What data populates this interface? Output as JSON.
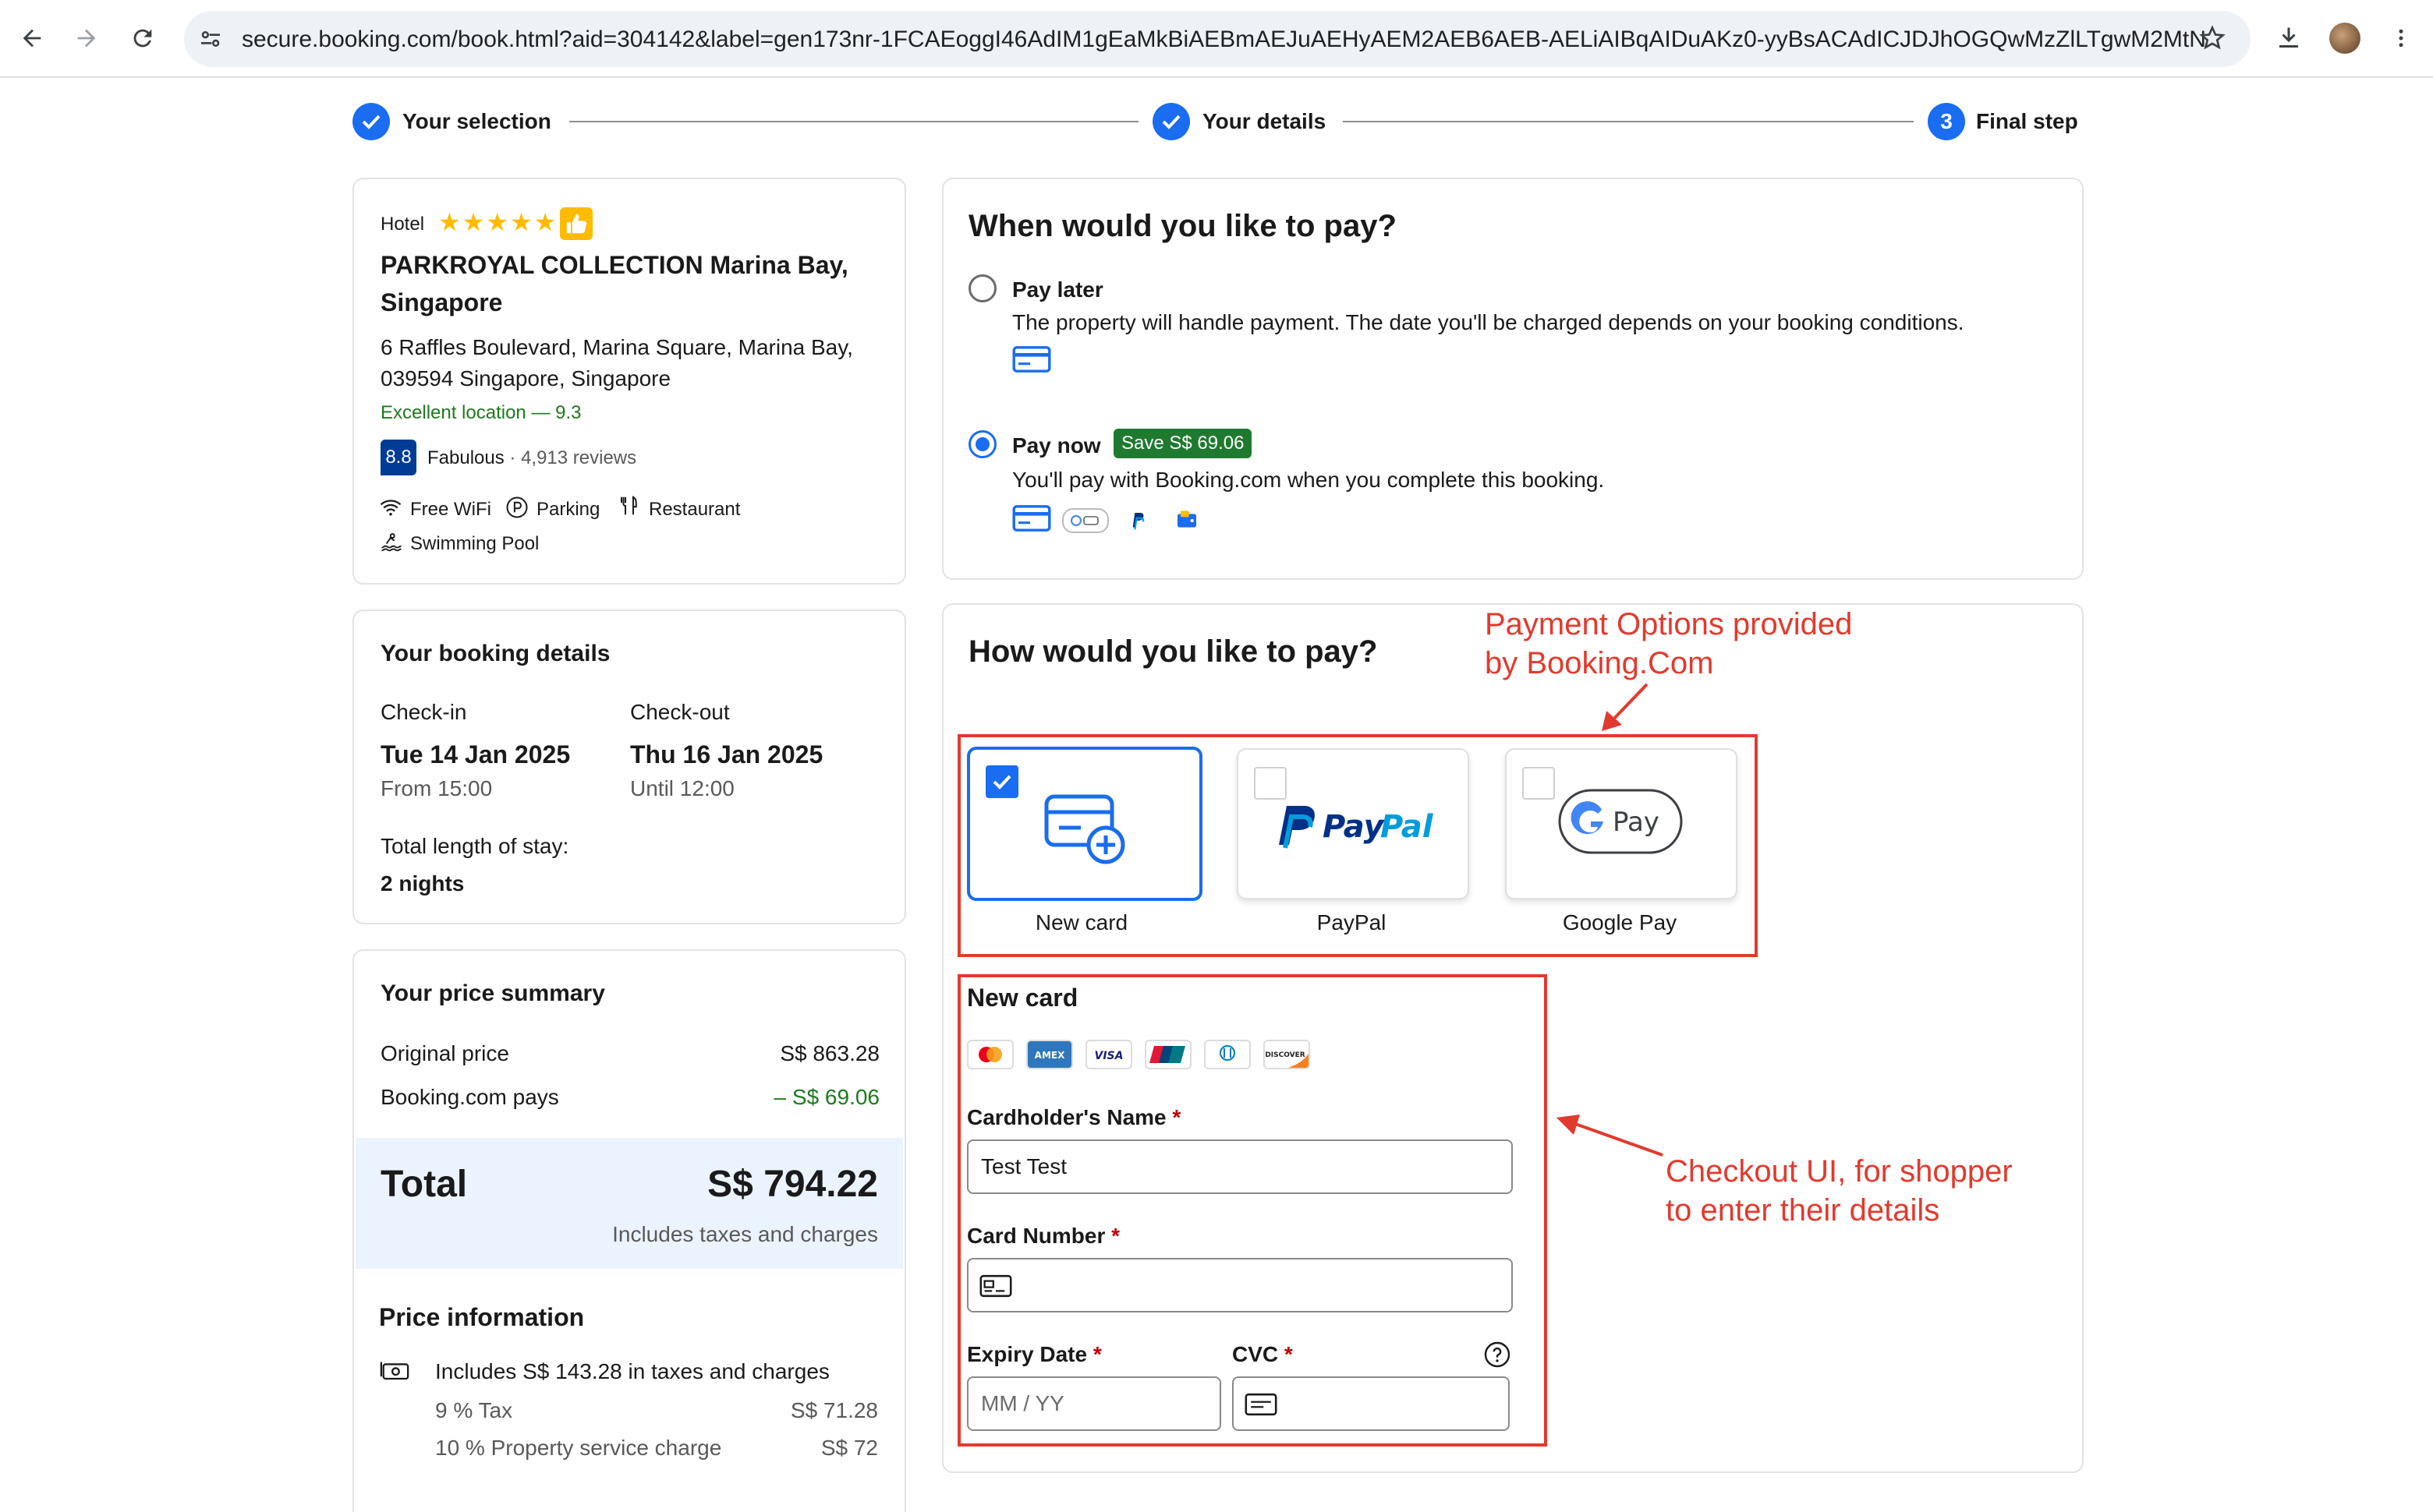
{
  "browser": {
    "url_host": "secure.booking.com",
    "url_rest": "/book.html?aid=304142&label=gen173nr-1FCAEoggI46AdIM1gEaMkBiAEBmAEJuAEHyAEM2AEB6AEB-AELiAIBqAIDuAKz0-yyBsACAdICJDJhOGQwMzZlLTgwM2MtNG..."
  },
  "steps": [
    {
      "label": "Your selection",
      "state": "done"
    },
    {
      "label": "Your details",
      "state": "done"
    },
    {
      "number": "3",
      "label": "Final step",
      "state": "current"
    }
  ],
  "hotel": {
    "type": "Hotel",
    "stars": "★★★★★",
    "name_line1": "PARKROYAL COLLECTION Marina Bay,",
    "name_line2": "Singapore",
    "address_line1": "6 Raffles Boulevard, Marina Square, Marina Bay,",
    "address_line2": "039594 Singapore, Singapore",
    "location": "Excellent location — 9.3",
    "score": "8.8",
    "score_word": "Fabulous",
    "reviews": " · 4,913 reviews",
    "amenities": [
      "Free WiFi",
      "Parking",
      "Restaurant",
      "Swimming Pool"
    ]
  },
  "booking": {
    "title": "Your booking details",
    "checkin_label": "Check-in",
    "checkin_date": "Tue 14 Jan 2025",
    "checkin_time": "From 15:00",
    "checkout_label": "Check-out",
    "checkout_date": "Thu 16 Jan 2025",
    "checkout_time": "Until 12:00",
    "stay_label": "Total length of stay:",
    "stay_value": "2 nights"
  },
  "price": {
    "title": "Your price summary",
    "original_label": "Original price",
    "original_value": "S$ 863.28",
    "bcom_label": "Booking.com pays",
    "bcom_value": "– S$ 69.06",
    "total_label": "Total",
    "total_value": "S$ 794.22",
    "total_note": "Includes taxes and charges",
    "info_title": "Price information",
    "info_line": "Includes S$ 143.28 in taxes and charges",
    "tax1_label": "9 % Tax",
    "tax1_value": "S$ 71.28",
    "tax2_label": "10 % Property service charge",
    "tax2_value": "S$ 72"
  },
  "when": {
    "title": "When would you like to pay?",
    "later_label": "Pay later",
    "later_desc": "The property will handle payment. The date you'll be charged depends on your booking conditions.",
    "now_label": "Pay now",
    "now_badge": "Save S$ 69.06",
    "now_desc": "You'll pay with Booking.com when you complete this booking.",
    "selected": "now"
  },
  "how": {
    "title": "How would you like to pay?",
    "options": [
      {
        "label": "New card",
        "selected": true
      },
      {
        "label": "PayPal",
        "selected": false
      },
      {
        "label": "Google Pay",
        "selected": false
      }
    ]
  },
  "newcard": {
    "title": "New card",
    "card_brands": [
      "mastercard-icon",
      "amex-icon",
      "visa-icon",
      "unionpay-icon",
      "diners-icon",
      "discover-icon"
    ],
    "name_label": "Cardholder's Name",
    "name_value": "Test Test",
    "number_label": "Card Number",
    "number_value": "",
    "expiry_label": "Expiry Date",
    "expiry_placeholder": "MM / YY",
    "cvc_label": "CVC",
    "required_mark": "*"
  },
  "annotations": {
    "options_line1": "Payment Options provided",
    "options_line2": "by Booking.Com",
    "checkout_line1": "Checkout UI, for shopper",
    "checkout_line2": "to enter their details",
    "color": "#e23a2e"
  },
  "colors": {
    "accent": "#1a6cf0",
    "success": "#1f7a2f",
    "score_bg": "#003b95"
  }
}
